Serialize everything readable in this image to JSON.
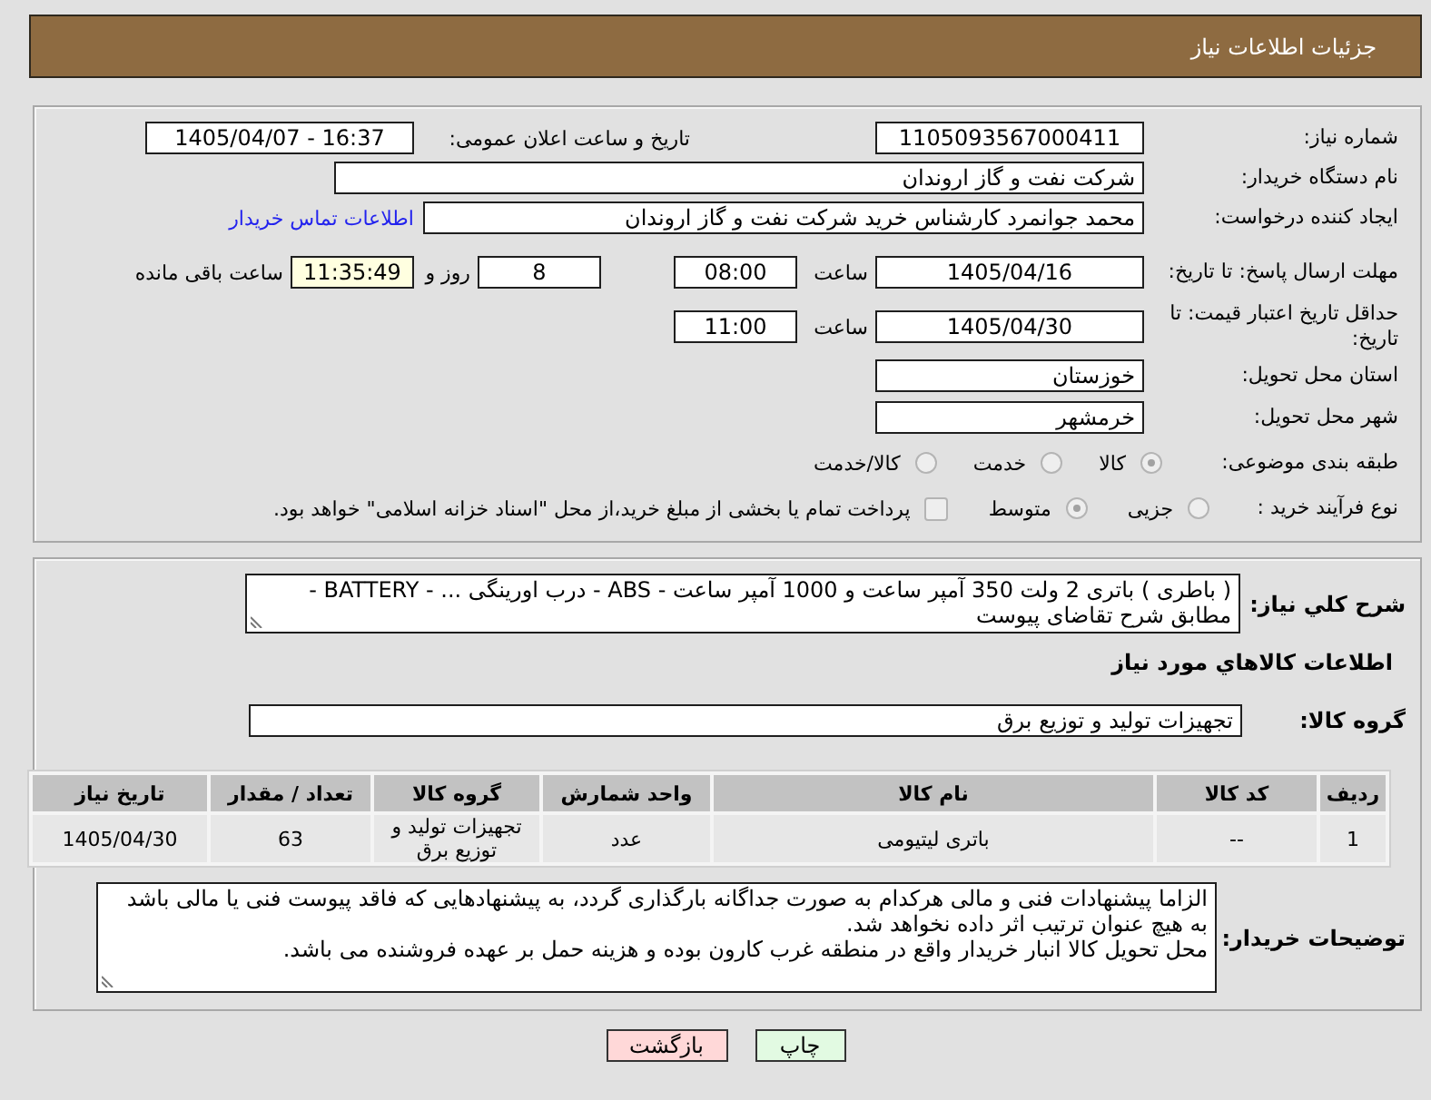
{
  "header": {
    "title": "جزئیات اطلاعات نیاز"
  },
  "general": {
    "need_number": {
      "label": "شماره نیاز:",
      "value": "1105093567000411"
    },
    "announce": {
      "label": "تاریخ و ساعت اعلان عمومی:",
      "value": "1405/04/07 - 16:37"
    },
    "buyer": {
      "label": "نام دستگاه خریدار:",
      "value": "شرکت نفت و گاز اروندان"
    },
    "requester": {
      "label": "ایجاد کننده درخواست:",
      "value": "محمد جوانمرد کارشناس خرید شرکت نفت و گاز اروندان",
      "link": "اطلاعات تماس خریدار"
    },
    "reply_deadline": {
      "label": "مهلت ارسال پاسخ: تا تاریخ:",
      "date": "1405/04/16",
      "time_label": "ساعت",
      "time": "08:00",
      "days": "8",
      "days_label": "روز و",
      "remaining": "11:35:49",
      "remaining_label": "ساعت باقی مانده"
    },
    "price_validity": {
      "label": "حداقل تاریخ اعتبار قیمت: تا تاریخ:",
      "date": "1405/04/30",
      "time_label": "ساعت",
      "time": "11:00"
    },
    "province": {
      "label": "استان محل تحویل:",
      "value": "خوزستان"
    },
    "city": {
      "label": "شهر محل تحویل:",
      "value": "خرمشهر"
    },
    "category": {
      "label": "طبقه بندی موضوعی:",
      "disabled": true,
      "options": [
        {
          "label": "کالا",
          "selected": true
        },
        {
          "label": "خدمت",
          "selected": false
        },
        {
          "label": "کالا/خدمت",
          "selected": false
        }
      ]
    },
    "process": {
      "label": "نوع فرآیند خرید :",
      "disabled": true,
      "options": [
        {
          "label": "جزیی",
          "selected": false
        },
        {
          "label": "متوسط",
          "selected": true
        }
      ],
      "treasury": {
        "label": "پرداخت تمام یا بخشی از مبلغ خرید،از محل \"اسناد خزانه اسلامی\" خواهد بود.",
        "checked": false,
        "disabled": true
      }
    }
  },
  "details": {
    "description": {
      "label": "شرح کلي نیاز:",
      "value": "( باطری ) باتری 2 ولت 350 آمپر ساعت و 1000 آمپر ساعت - ABS - درب اورینگی ... - BATTERY - مطابق شرح تقاضای پیوست"
    },
    "goods_title": "اطلاعات کالاهاي مورد نیاز",
    "goods_group": {
      "label": "گروه کالا:",
      "value": "تجهیزات تولید و توزیع برق"
    },
    "table": {
      "columns": [
        "ردیف",
        "کد کالا",
        "نام کالا",
        "واحد شمارش",
        "گروه کالا",
        "تعداد / مقدار",
        "تاریخ نیاز"
      ],
      "rows": [
        [
          "1",
          "--",
          "باتری لیتیومی",
          "عدد",
          "تجهیزات تولید و توزیع برق",
          "63",
          "1405/04/30"
        ]
      ]
    },
    "notes": {
      "label": "توضیحات خریدار:",
      "value": "الزاما پیشنهادات فنی و مالی هرکدام به صورت جداگانه بارگذاری گردد، به پیشنهادهایی که فاقد پیوست فنی یا مالی باشد به هیچ عنوان ترتیب اثر داده نخواهد شد.\nمحل تحویل کالا انبار خریدار واقع در منطقه غرب کارون بوده و هزینه حمل بر عهده فروشنده می باشد."
    }
  },
  "buttons": [
    {
      "label": "چاپ",
      "color": "#e2fae2"
    },
    {
      "label": "بازگشت",
      "color": "#ffd8d8"
    }
  ]
}
